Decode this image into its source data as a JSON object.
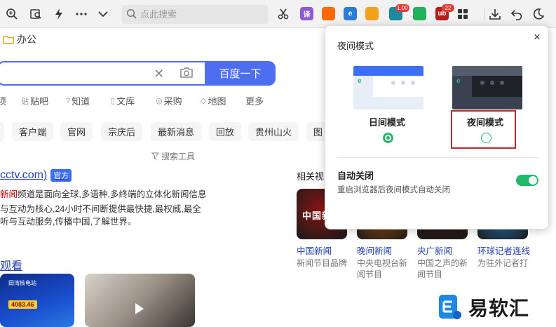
{
  "toolbar": {
    "search_placeholder": "点此搜索",
    "extensions": [
      {
        "name": "translate-ext",
        "label": "译",
        "color": "#8e5bd6"
      },
      {
        "name": "game-ext",
        "label": "",
        "color": "#ff6a00"
      },
      {
        "name": "ie-ext",
        "label": "e",
        "color": "#2e7bd6"
      },
      {
        "name": "fox-ext",
        "label": "",
        "color": "#f4a21b"
      },
      {
        "name": "play-ext",
        "label": "",
        "color": "#1b8a9e",
        "badge": "1.00"
      },
      {
        "name": "book-ext",
        "label": "",
        "color": "#20b15a"
      },
      {
        "name": "ublock-ext",
        "label": "ub",
        "color": "#b71c1c",
        "badge": "22"
      }
    ]
  },
  "bookmarks": {
    "folder_label": "办公"
  },
  "search": {
    "button_label": "百度一下"
  },
  "nav": [
    {
      "label": "项",
      "icon": ""
    },
    {
      "label": "贴吧",
      "icon": "贴"
    },
    {
      "label": "知道",
      "icon": "?"
    },
    {
      "label": "文库",
      "icon": "▯"
    },
    {
      "label": "采购",
      "icon": "◎"
    },
    {
      "label": "地图",
      "icon": "◇"
    },
    {
      "label": "更多",
      "icon": ""
    }
  ],
  "chips": [
    "",
    "客户端",
    "官网",
    "宗庆后",
    "最新消息",
    "回放",
    "贵州山火",
    "图"
  ],
  "tools_label": "搜索工具",
  "result": {
    "title": "cctv.com)",
    "badge": "官方",
    "line1_red": "新闻",
    "line1": "频道是面向全球,多语种,多终端的立体化新闻信息",
    "line2": "与互动为核心,24小时不间断提供最快捷,最权威,最全",
    "line3": "听与互动服务,传播中国,了解世界。",
    "watch": "观看"
  },
  "thumb1": {
    "label": "田湾核电站",
    "num": "4083.46"
  },
  "related": {
    "heading": "相关视",
    "videos": [
      {
        "img_text": "中国新闻",
        "color": "#8a1414",
        "title": "中国新闻",
        "sub": "新闻节目品牌"
      },
      {
        "img_text": "晚间",
        "color": "#b45a0e",
        "title": "晚间新闻",
        "sub": "中央电视台新闻节目"
      },
      {
        "img_text": "央广新闻",
        "color": "#3b1a12",
        "title": "央广新闻",
        "sub": "中国之声的新闻节目"
      },
      {
        "img_text": "记者连线",
        "color": "#2b8bd9",
        "title": "环球记者连线",
        "sub": "为驻外记者打"
      }
    ]
  },
  "popup": {
    "title": "夜间模式",
    "close": "×",
    "day_label": "日间模式",
    "night_label": "夜间模式",
    "auto_title": "自动关闭",
    "auto_desc": "重启浏览器后夜间模式自动关闭",
    "auto_on": true,
    "selected_mode": "day"
  },
  "watermark": {
    "text": "易软汇"
  }
}
